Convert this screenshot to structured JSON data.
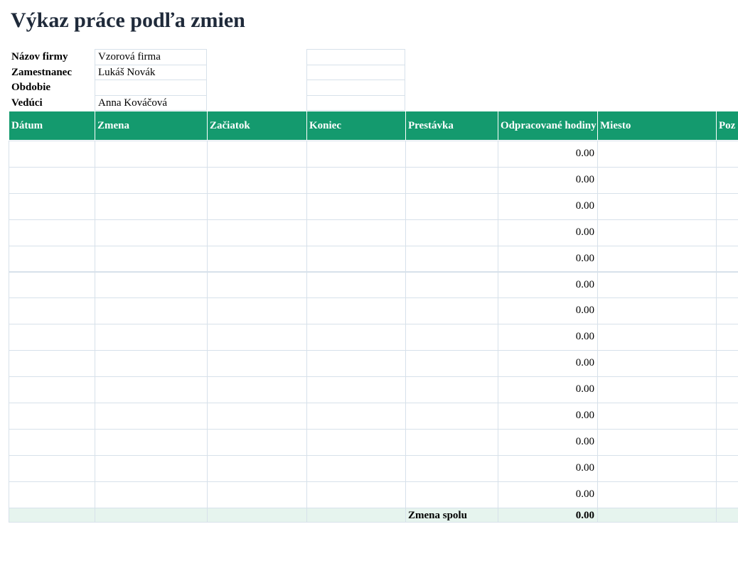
{
  "title": "Výkaz práce podľa zmien",
  "info": [
    {
      "label": "Názov firmy",
      "value": "Vzorová firma"
    },
    {
      "label": "Zamestnanec",
      "value": "Lukáš Novák"
    },
    {
      "label": "Obdobie",
      "value": ""
    },
    {
      "label": "Vedúci",
      "value": "Anna Kováčová"
    }
  ],
  "columns": [
    "Dátum",
    "Zmena",
    "Začiatok",
    "Koniec",
    "Prestávka",
    "Odpracované hodiny",
    "Miesto",
    "Poz"
  ],
  "rows": [
    {
      "hours": "0.00"
    },
    {
      "hours": "0.00"
    },
    {
      "hours": "0.00"
    },
    {
      "hours": "0.00"
    },
    {
      "hours": "0.00"
    },
    {
      "hours": "0.00"
    },
    {
      "hours": "0.00"
    },
    {
      "hours": "0.00"
    },
    {
      "hours": "0.00"
    },
    {
      "hours": "0.00"
    },
    {
      "hours": "0.00"
    },
    {
      "hours": "0.00"
    },
    {
      "hours": "0.00"
    },
    {
      "hours": "0.00"
    }
  ],
  "total": {
    "label": "Zmena spolu",
    "value": "0.00"
  },
  "colors": {
    "header_bg": "#149a6e",
    "header_text": "#ffffff",
    "total_bg": "#e6f4ee",
    "title_text": "#1f2a3a"
  }
}
